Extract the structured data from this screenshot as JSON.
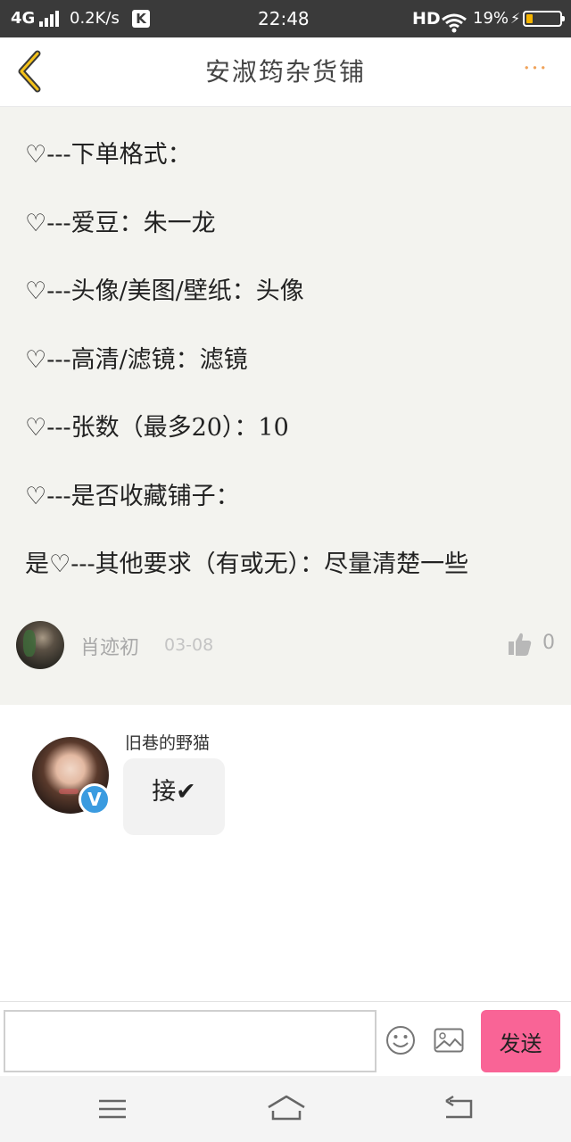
{
  "status_bar": {
    "network": "4G",
    "speed": "0.2K/s",
    "app_badge": "K",
    "time": "22:48",
    "hd": "HD",
    "battery_pct": "19%",
    "battery_level": 0.19,
    "charging_icon": "bolt-icon"
  },
  "header": {
    "title": "安淑筠杂货铺",
    "back_icon": "chevron-left-icon",
    "more_icon": "more-dots-icon",
    "more_label": "···",
    "accent_color": "#f0a35a"
  },
  "post": {
    "lines": [
      "♡---下单格式：",
      "♡---爱豆：朱一龙",
      "♡---头像/美图/壁纸：头像",
      "♡---高清/滤镜：滤镜",
      "♡---张数（最多20）：10",
      "♡---是否收藏铺子：",
      "是♡---其他要求（有或无）：尽量清楚一些"
    ],
    "author": "肖迹初",
    "date": "03-08",
    "like_count": "0",
    "like_icon": "thumbs-up-icon"
  },
  "reply": {
    "name": "旧巷的野猫",
    "text": "接✔",
    "verified_label": "V"
  },
  "input_bar": {
    "placeholder": "",
    "send_label": "发送",
    "send_color": "#f96496",
    "emoji_icon": "emoji-icon",
    "image_icon": "image-icon"
  },
  "nav": {
    "menu_icon": "menu-icon",
    "home_icon": "home-icon",
    "back_icon": "back-arrow-icon"
  }
}
